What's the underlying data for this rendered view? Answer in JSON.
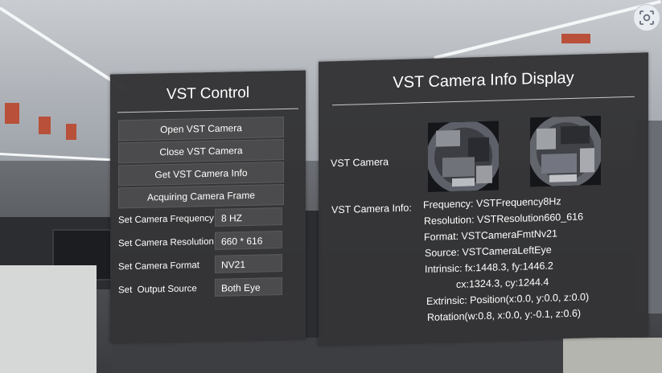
{
  "left_panel": {
    "title": "VST Control",
    "buttons": [
      "Open VST Camera",
      "Close VST Camera",
      "Get VST Camera Info",
      "Acquiring Camera Frame"
    ],
    "settings": [
      {
        "label": "Set Camera Frequency",
        "value": "8 HZ"
      },
      {
        "label": "Set Camera Resolution",
        "value": "660 * 616"
      },
      {
        "label": "Set Camera Format",
        "value": "NV21"
      },
      {
        "label": "Set  Output Source",
        "value": "Both Eye"
      }
    ]
  },
  "right_panel": {
    "title": "VST Camera Info Display",
    "camera_label": "VST Camera",
    "info_label": "VST Camera Info:",
    "info_lines": [
      "Frequency: VSTFrequency8Hz",
      "Resolution: VSTResolution660_616",
      "Format: VSTCameraFmtNv21",
      "Source: VSTCameraLeftEye",
      "Intrinsic: fx:1448.3, fy:1446.2",
      "cx:1324.3, cy:1244.4",
      "Extrinsic: Position(x:0.0, y:0.0, z:0.0)",
      "Rotation(w:0.8, x:0.0, y:-0.1, z:0.6)"
    ]
  },
  "icons": {
    "corner_button": "screenshot-scan-icon"
  },
  "colors": {
    "panel_bg": "#343436",
    "control_bg": "#4b4b4d",
    "text": "#ffffff"
  }
}
